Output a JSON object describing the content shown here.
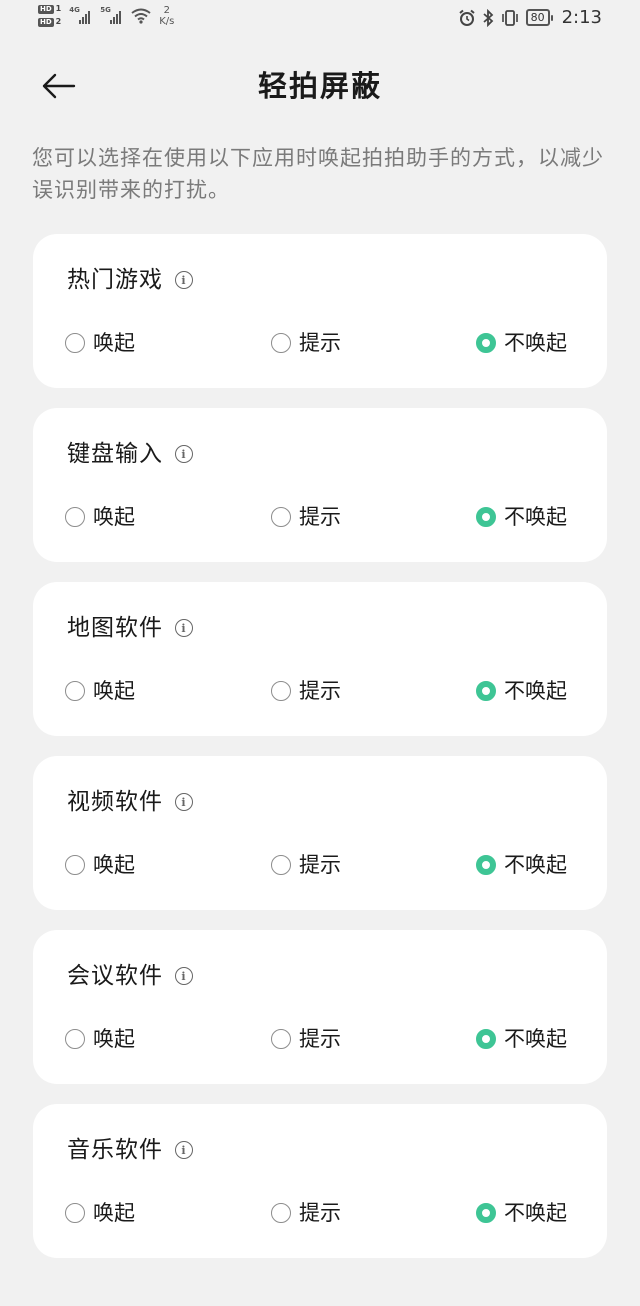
{
  "status_bar": {
    "hd1": "HD",
    "hd1_num": "1",
    "hd2": "HD",
    "hd2_num": "2",
    "net1": "4G",
    "net2": "5G",
    "speed_value": "2",
    "speed_unit": "K/s",
    "battery": "80",
    "time": "2:13"
  },
  "header": {
    "title": "轻拍屏蔽"
  },
  "description": "您可以选择在使用以下应用时唤起拍拍助手的方式，以减少误识别带来的打扰。",
  "options": {
    "wake": "唤起",
    "hint": "提示",
    "no_wake": "不唤起"
  },
  "categories": [
    {
      "title": "热门游戏",
      "selected": "不唤起"
    },
    {
      "title": "键盘输入",
      "selected": "不唤起"
    },
    {
      "title": "地图软件",
      "selected": "不唤起"
    },
    {
      "title": "视频软件",
      "selected": "不唤起"
    },
    {
      "title": "会议软件",
      "selected": "不唤起"
    },
    {
      "title": "音乐软件",
      "selected": "不唤起"
    }
  ],
  "colors": {
    "accent": "#3ec595",
    "background": "#f1f1f1",
    "card": "#ffffff",
    "description": "#7a7a7a"
  },
  "icons": {
    "back": "arrow-left-icon",
    "info": "info-icon",
    "alarm": "alarm-icon",
    "bluetooth": "bluetooth-icon",
    "vibrate": "vibrate-icon",
    "wifi": "wifi-icon"
  }
}
